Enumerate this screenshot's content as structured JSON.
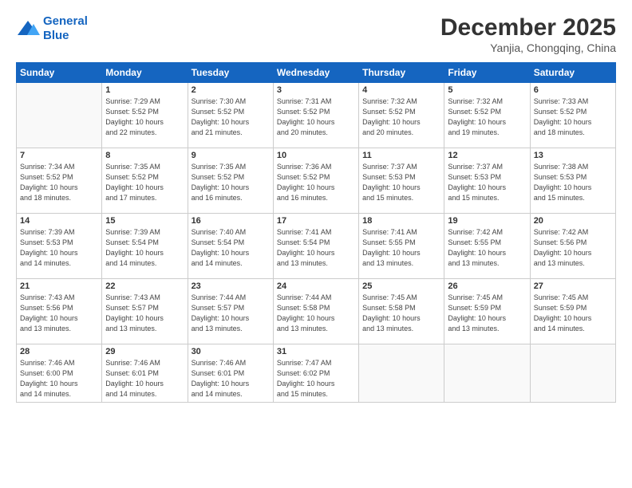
{
  "logo": {
    "line1": "General",
    "line2": "Blue"
  },
  "header": {
    "month": "December 2025",
    "location": "Yanjia, Chongqing, China"
  },
  "weekdays": [
    "Sunday",
    "Monday",
    "Tuesday",
    "Wednesday",
    "Thursday",
    "Friday",
    "Saturday"
  ],
  "weeks": [
    [
      {
        "day": "",
        "info": ""
      },
      {
        "day": "1",
        "info": "Sunrise: 7:29 AM\nSunset: 5:52 PM\nDaylight: 10 hours\nand 22 minutes."
      },
      {
        "day": "2",
        "info": "Sunrise: 7:30 AM\nSunset: 5:52 PM\nDaylight: 10 hours\nand 21 minutes."
      },
      {
        "day": "3",
        "info": "Sunrise: 7:31 AM\nSunset: 5:52 PM\nDaylight: 10 hours\nand 20 minutes."
      },
      {
        "day": "4",
        "info": "Sunrise: 7:32 AM\nSunset: 5:52 PM\nDaylight: 10 hours\nand 20 minutes."
      },
      {
        "day": "5",
        "info": "Sunrise: 7:32 AM\nSunset: 5:52 PM\nDaylight: 10 hours\nand 19 minutes."
      },
      {
        "day": "6",
        "info": "Sunrise: 7:33 AM\nSunset: 5:52 PM\nDaylight: 10 hours\nand 18 minutes."
      }
    ],
    [
      {
        "day": "7",
        "info": "Sunrise: 7:34 AM\nSunset: 5:52 PM\nDaylight: 10 hours\nand 18 minutes."
      },
      {
        "day": "8",
        "info": "Sunrise: 7:35 AM\nSunset: 5:52 PM\nDaylight: 10 hours\nand 17 minutes."
      },
      {
        "day": "9",
        "info": "Sunrise: 7:35 AM\nSunset: 5:52 PM\nDaylight: 10 hours\nand 16 minutes."
      },
      {
        "day": "10",
        "info": "Sunrise: 7:36 AM\nSunset: 5:52 PM\nDaylight: 10 hours\nand 16 minutes."
      },
      {
        "day": "11",
        "info": "Sunrise: 7:37 AM\nSunset: 5:53 PM\nDaylight: 10 hours\nand 15 minutes."
      },
      {
        "day": "12",
        "info": "Sunrise: 7:37 AM\nSunset: 5:53 PM\nDaylight: 10 hours\nand 15 minutes."
      },
      {
        "day": "13",
        "info": "Sunrise: 7:38 AM\nSunset: 5:53 PM\nDaylight: 10 hours\nand 15 minutes."
      }
    ],
    [
      {
        "day": "14",
        "info": "Sunrise: 7:39 AM\nSunset: 5:53 PM\nDaylight: 10 hours\nand 14 minutes."
      },
      {
        "day": "15",
        "info": "Sunrise: 7:39 AM\nSunset: 5:54 PM\nDaylight: 10 hours\nand 14 minutes."
      },
      {
        "day": "16",
        "info": "Sunrise: 7:40 AM\nSunset: 5:54 PM\nDaylight: 10 hours\nand 14 minutes."
      },
      {
        "day": "17",
        "info": "Sunrise: 7:41 AM\nSunset: 5:54 PM\nDaylight: 10 hours\nand 13 minutes."
      },
      {
        "day": "18",
        "info": "Sunrise: 7:41 AM\nSunset: 5:55 PM\nDaylight: 10 hours\nand 13 minutes."
      },
      {
        "day": "19",
        "info": "Sunrise: 7:42 AM\nSunset: 5:55 PM\nDaylight: 10 hours\nand 13 minutes."
      },
      {
        "day": "20",
        "info": "Sunrise: 7:42 AM\nSunset: 5:56 PM\nDaylight: 10 hours\nand 13 minutes."
      }
    ],
    [
      {
        "day": "21",
        "info": "Sunrise: 7:43 AM\nSunset: 5:56 PM\nDaylight: 10 hours\nand 13 minutes."
      },
      {
        "day": "22",
        "info": "Sunrise: 7:43 AM\nSunset: 5:57 PM\nDaylight: 10 hours\nand 13 minutes."
      },
      {
        "day": "23",
        "info": "Sunrise: 7:44 AM\nSunset: 5:57 PM\nDaylight: 10 hours\nand 13 minutes."
      },
      {
        "day": "24",
        "info": "Sunrise: 7:44 AM\nSunset: 5:58 PM\nDaylight: 10 hours\nand 13 minutes."
      },
      {
        "day": "25",
        "info": "Sunrise: 7:45 AM\nSunset: 5:58 PM\nDaylight: 10 hours\nand 13 minutes."
      },
      {
        "day": "26",
        "info": "Sunrise: 7:45 AM\nSunset: 5:59 PM\nDaylight: 10 hours\nand 13 minutes."
      },
      {
        "day": "27",
        "info": "Sunrise: 7:45 AM\nSunset: 5:59 PM\nDaylight: 10 hours\nand 14 minutes."
      }
    ],
    [
      {
        "day": "28",
        "info": "Sunrise: 7:46 AM\nSunset: 6:00 PM\nDaylight: 10 hours\nand 14 minutes."
      },
      {
        "day": "29",
        "info": "Sunrise: 7:46 AM\nSunset: 6:01 PM\nDaylight: 10 hours\nand 14 minutes."
      },
      {
        "day": "30",
        "info": "Sunrise: 7:46 AM\nSunset: 6:01 PM\nDaylight: 10 hours\nand 14 minutes."
      },
      {
        "day": "31",
        "info": "Sunrise: 7:47 AM\nSunset: 6:02 PM\nDaylight: 10 hours\nand 15 minutes."
      },
      {
        "day": "",
        "info": ""
      },
      {
        "day": "",
        "info": ""
      },
      {
        "day": "",
        "info": ""
      }
    ]
  ]
}
